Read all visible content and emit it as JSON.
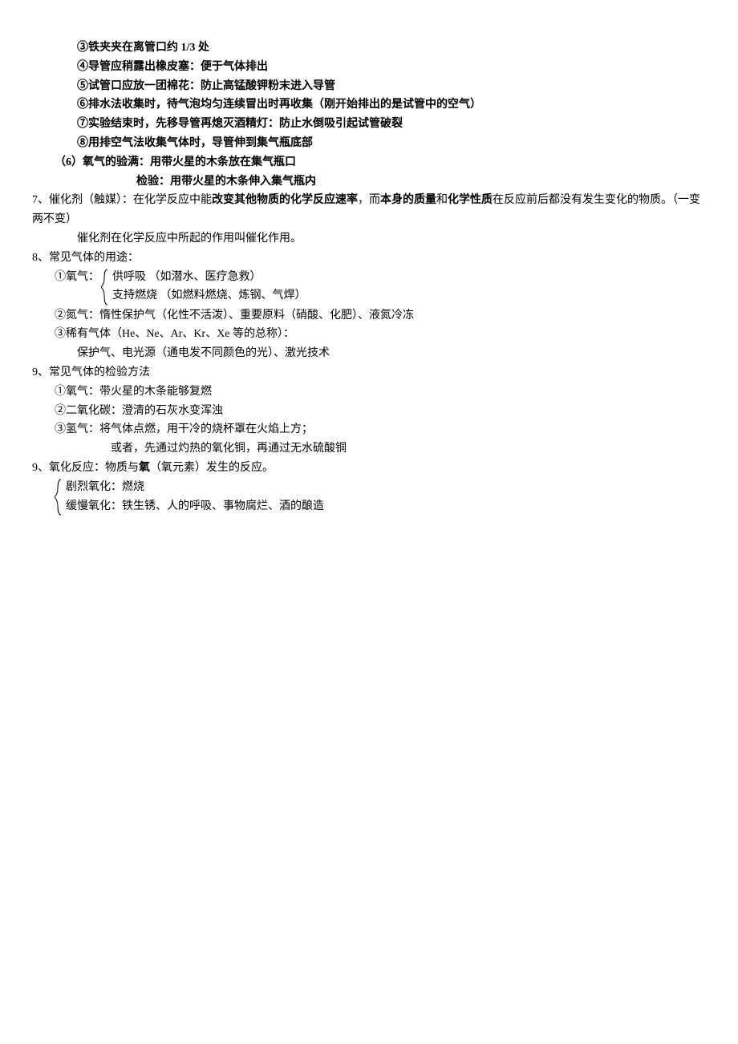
{
  "lines": {
    "l1": "③铁夹夹在离管口约 1/3 处",
    "l2": "④导管应稍露出橡皮塞：便于气体排出",
    "l3": "⑤试管口应放一团棉花：防止高锰酸钾粉末进入导管",
    "l4": "⑥排水法收集时，待气泡均匀连续冒出时再收集（刚开始排出的是试管中的空气）",
    "l5": "⑦实验结束时，先移导管再熄灭酒精灯：防止水倒吸引起试管破裂",
    "l6": "⑧用排空气法收集气体时，导管伸到集气瓶底部",
    "l7": "（6）氧气的验满：用带火星的木条放在集气瓶口",
    "l8": "检验：用带火星的木条伸入集气瓶内",
    "l9a": "7、催化剂（触媒）：在化学反应中能",
    "l9b": "改变其他物质的化学反应速率",
    "l9c": "，而",
    "l9d": "本身的质量",
    "l9e": "和",
    "l9f": "化学性质",
    "l9g": "在反应前后都没有发生变化的物质。（一变两不变）",
    "l10": "催化剂在化学反应中所起的作用叫催化作用。",
    "l11": "8、常见气体的用途：",
    "l12_prefix": "①氧气：",
    "l12a": "供呼吸 （如潜水、医疗急救）",
    "l12b": "支持燃烧 （如燃料燃烧、炼钢、气焊）",
    "l13": "②氮气：惰性保护气（化性不活泼）、重要原料（硝酸、化肥）、液氮冷冻",
    "l14": "③稀有气体（He、Ne、Ar、Kr、Xe 等的总称）：",
    "l15": "保护气、电光源（通电发不同颜色的光）、激光技术",
    "l16": "9、常见气体的检验方法",
    "l17": "①氧气：带火星的木条能够复燃",
    "l18": "②二氧化碳：澄清的石灰水变浑浊",
    "l19": "③氢气：将气体点燃，用干冷的烧杯罩在火焰上方；",
    "l20": "或者，先通过灼热的氧化铜，再通过无水硫酸铜",
    "l21a": "9、氧化反应：物质与",
    "l21b": "氧",
    "l21c": "（氧元素）发生的反应。",
    "l22a": "剧烈氧化：燃烧",
    "l22b": "缓慢氧化：铁生锈、人的呼吸、事物腐烂、酒的酿造"
  }
}
